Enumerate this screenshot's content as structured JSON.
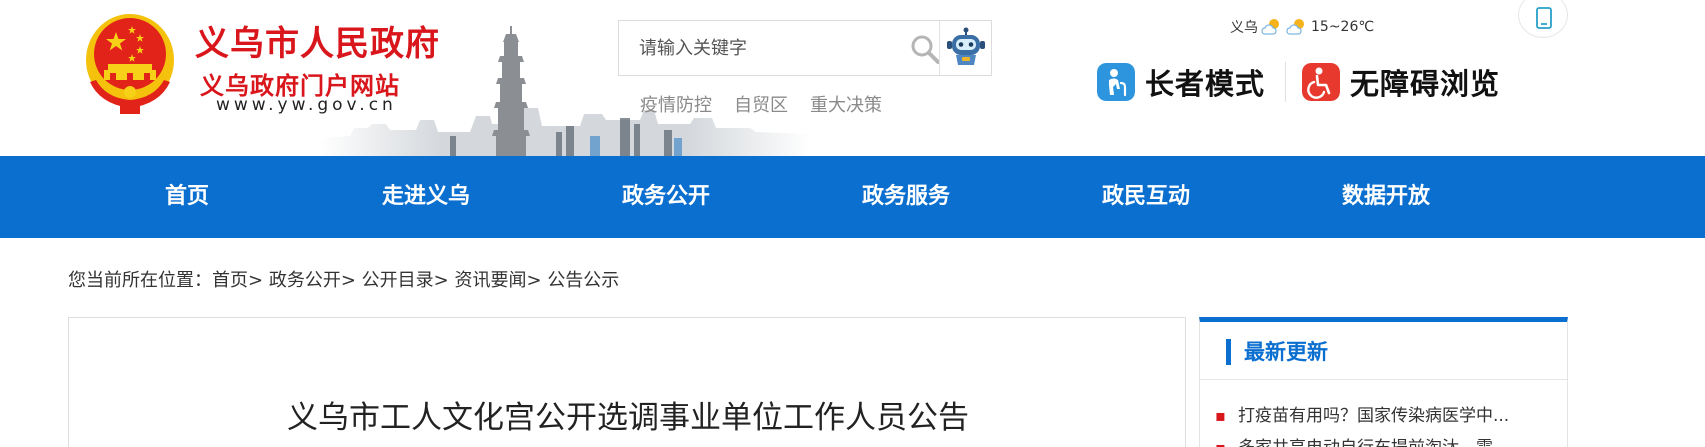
{
  "header": {
    "site_title": "义乌市人民政府",
    "site_subtitle": "义乌政府门户网站",
    "site_url": "www.yw.gov.cn",
    "search": {
      "placeholder": "请输入关键字"
    },
    "hot_links": [
      "疫情防控",
      "自贸区",
      "重大决策"
    ],
    "weather": {
      "city": "义乌",
      "temperature": "15~26℃"
    },
    "elder_mode_label": "长者模式",
    "accessible_label": "无障碍浏览"
  },
  "nav": {
    "items": [
      "首页",
      "走进义乌",
      "政务公开",
      "政务服务",
      "政民互动",
      "数据开放"
    ]
  },
  "breadcrumb": {
    "prefix": "您当前所在位置：",
    "items": [
      "首页",
      "政务公开",
      "公开目录",
      "资讯要闻",
      "公告公示"
    ],
    "separator": ">"
  },
  "article": {
    "title": "义乌市工人文化宫公开选调事业单位工作人员公告"
  },
  "sidebar": {
    "title": "最新更新",
    "items": [
      "打疫苗有用吗？国家传染病医学中...",
      "多家共享电动自行车提前淘汰，需..."
    ]
  },
  "colors": {
    "brand_red": "#d9161b",
    "nav_blue": "#0b6fcf"
  }
}
